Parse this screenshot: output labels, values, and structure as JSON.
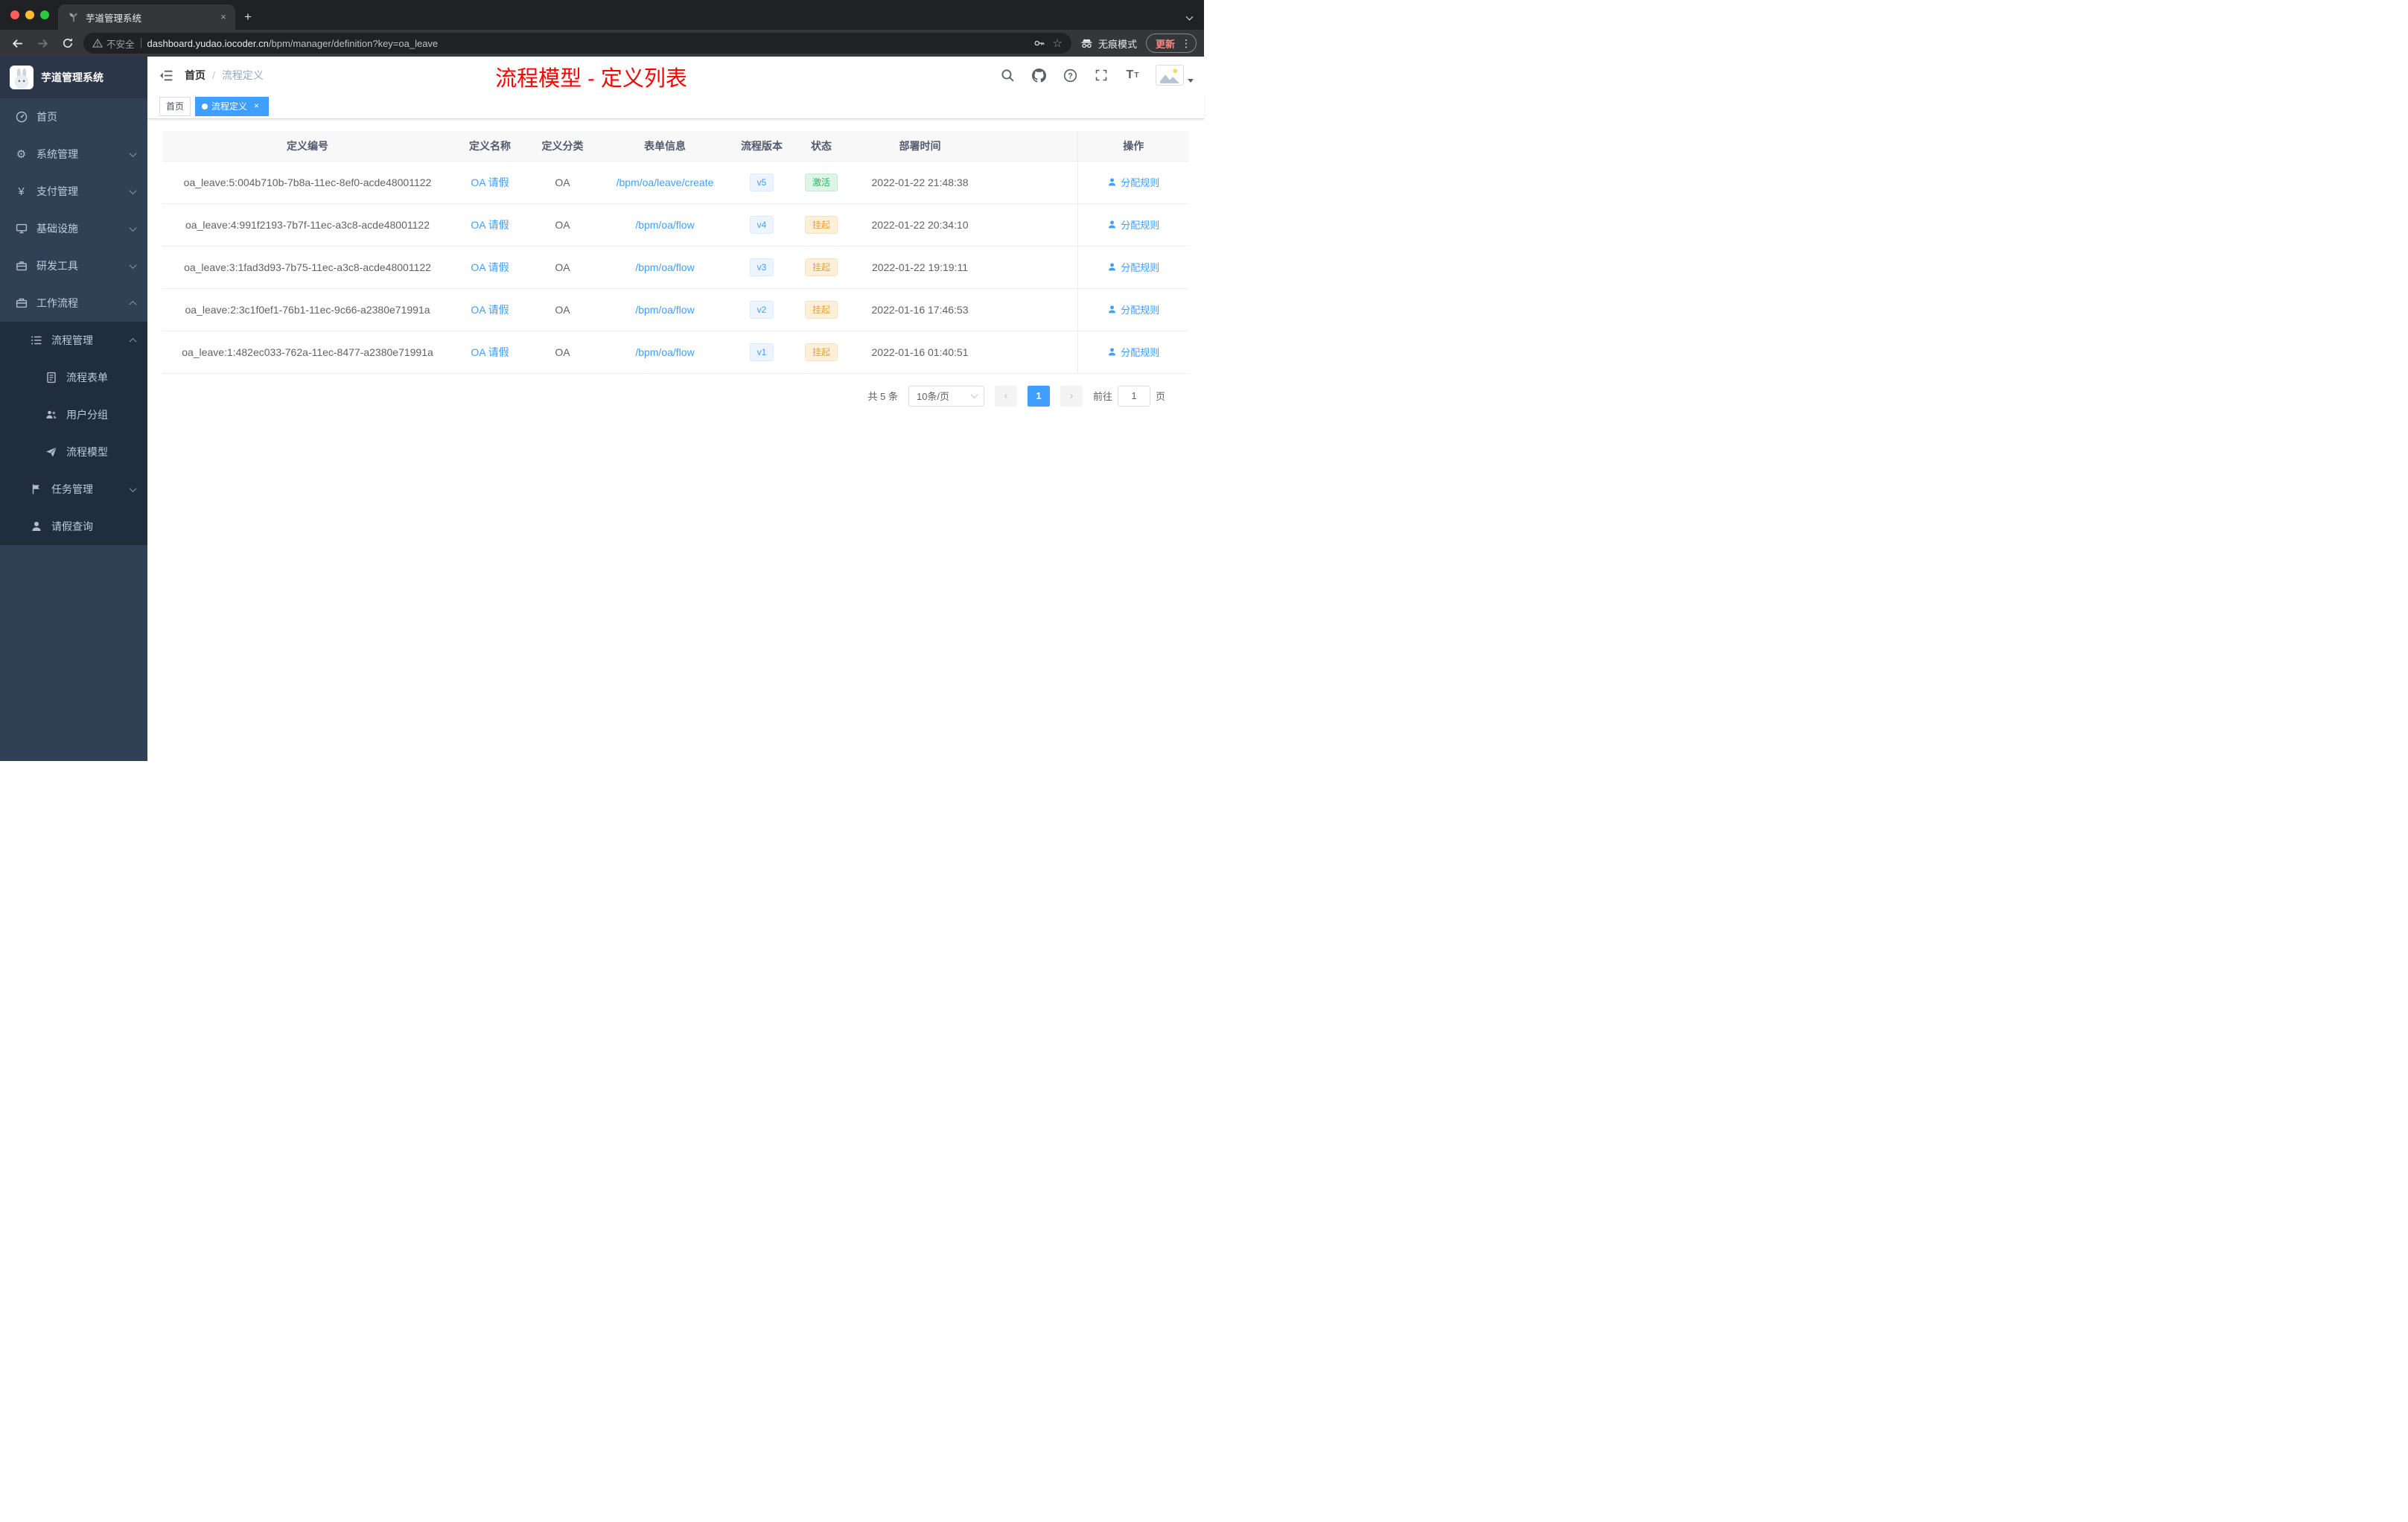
{
  "browser": {
    "tab_title": "芋道管理系统",
    "security_label": "不安全",
    "url_host": "dashboard.yudao.iocoder.cn",
    "url_path": "/bpm/manager/definition?key=oa_leave",
    "incognito_label": "无痕模式",
    "update_label": "更新"
  },
  "icons": {
    "close": "×",
    "new_tab": "+",
    "star": "☆",
    "menu_dots": "⋮",
    "gear": "⚙",
    "yen": "¥",
    "font_size": "T",
    "prev": "‹",
    "next": "›"
  },
  "sidebar": {
    "logo_title": "芋道管理系统",
    "menu": [
      {
        "label": "首页"
      },
      {
        "label": "系统管理"
      },
      {
        "label": "支付管理"
      },
      {
        "label": "基础设施"
      },
      {
        "label": "研发工具"
      },
      {
        "label": "工作流程"
      },
      {
        "label": "流程管理"
      },
      {
        "label": "流程表单"
      },
      {
        "label": "用户分组"
      },
      {
        "label": "流程模型"
      },
      {
        "label": "任务管理"
      },
      {
        "label": "请假查询"
      }
    ]
  },
  "header": {
    "breadcrumb": {
      "home": "首页",
      "separator": "/",
      "current": "流程定义"
    },
    "annotation": "流程模型 - 定义列表"
  },
  "tags": {
    "home": "首页",
    "active": "流程定义"
  },
  "table": {
    "columns": [
      "定义编号",
      "定义名称",
      "定义分类",
      "表单信息",
      "流程版本",
      "状态",
      "部署时间",
      "操作"
    ],
    "rows": [
      {
        "id": "oa_leave:5:004b710b-7b8a-11ec-8ef0-acde48001122",
        "name": "OA 请假",
        "category": "OA",
        "form": "/bpm/oa/leave/create",
        "version": "v5",
        "status": "激活",
        "status_class": "success",
        "deployed": "2022-01-22 21:48:38",
        "action": "分配规则"
      },
      {
        "id": "oa_leave:4:991f2193-7b7f-11ec-a3c8-acde48001122",
        "name": "OA 请假",
        "category": "OA",
        "form": "/bpm/oa/flow",
        "version": "v4",
        "status": "挂起",
        "status_class": "warning",
        "deployed": "2022-01-22 20:34:10",
        "action": "分配规则"
      },
      {
        "id": "oa_leave:3:1fad3d93-7b75-11ec-a3c8-acde48001122",
        "name": "OA 请假",
        "category": "OA",
        "form": "/bpm/oa/flow",
        "version": "v3",
        "status": "挂起",
        "status_class": "warning",
        "deployed": "2022-01-22 19:19:11",
        "action": "分配规则"
      },
      {
        "id": "oa_leave:2:3c1f0ef1-76b1-11ec-9c66-a2380e71991a",
        "name": "OA 请假",
        "category": "OA",
        "form": "/bpm/oa/flow",
        "version": "v2",
        "status": "挂起",
        "status_class": "warning",
        "deployed": "2022-01-16 17:46:53",
        "action": "分配规则"
      },
      {
        "id": "oa_leave:1:482ec033-762a-11ec-8477-a2380e71991a",
        "name": "OA 请假",
        "category": "OA",
        "form": "/bpm/oa/flow",
        "version": "v1",
        "status": "挂起",
        "status_class": "warning",
        "deployed": "2022-01-16 01:40:51",
        "action": "分配规则"
      }
    ]
  },
  "pagination": {
    "total": "共 5 条",
    "page_size": "10条/页",
    "current_page": "1",
    "goto_label": "前往",
    "goto_value": "1",
    "page_unit": "页"
  },
  "colors": {
    "accent": "#409eff",
    "sidebar_bg": "#304156",
    "submenu_bg": "#1f2d3d",
    "annotation_red": "#fe0000",
    "status_active_green": "#1cbb63",
    "status_suspend_orange": "#e6a23c"
  }
}
